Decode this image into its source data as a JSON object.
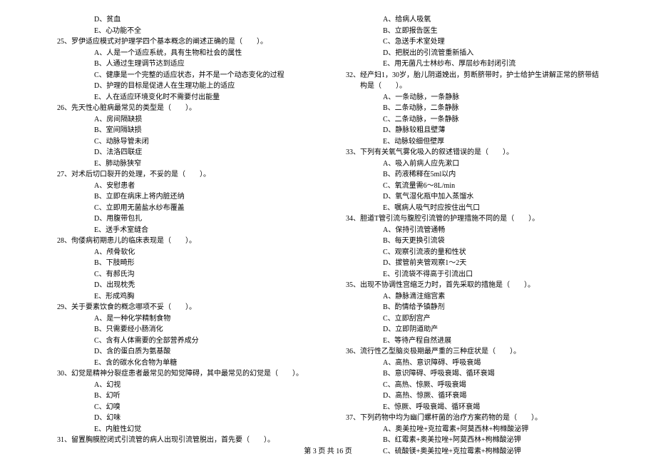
{
  "left": [
    {
      "type": "option",
      "text": "D、贫血"
    },
    {
      "type": "option",
      "text": "E、心功能不全"
    },
    {
      "type": "question",
      "text": "25、罗伊适应模式对护理学四个基本概念的阐述正确的是（　　）。"
    },
    {
      "type": "option",
      "text": "A、人是一个适应系统，具有生物和社会的属性"
    },
    {
      "type": "option",
      "text": "B、人通过生理调节达到适应"
    },
    {
      "type": "option",
      "text": "C、健康是一个完整的适应状态，并不是一个动态变化的过程"
    },
    {
      "type": "option",
      "text": "D、护理的目标是促进人在生理功能上的适应"
    },
    {
      "type": "option",
      "text": "E、人在适应环境变化时不需要付出能量"
    },
    {
      "type": "question",
      "text": "26、先天性心脏病最常见的类型是（　　）。"
    },
    {
      "type": "option",
      "text": "A、房间隔缺损"
    },
    {
      "type": "option",
      "text": "B、室间隔缺损"
    },
    {
      "type": "option",
      "text": "C、动脉导管未闭"
    },
    {
      "type": "option",
      "text": "D、法洛四联症"
    },
    {
      "type": "option",
      "text": "E、肺动脉狭窄"
    },
    {
      "type": "question",
      "text": "27、对术后切口裂开的处理，不妥的是（　　）。"
    },
    {
      "type": "option",
      "text": "A、安慰患者"
    },
    {
      "type": "option",
      "text": "B、立即在病床上将内脏还纳"
    },
    {
      "type": "option",
      "text": "C、立即用无菌盐水纱布覆盖"
    },
    {
      "type": "option",
      "text": "D、用腹带包扎"
    },
    {
      "type": "option",
      "text": "E、送手术室缝合"
    },
    {
      "type": "question",
      "text": "28、佝偻病初期患儿的临床表现是（　　）。"
    },
    {
      "type": "option",
      "text": "A、颅骨软化"
    },
    {
      "type": "option",
      "text": "B、下肢畸形"
    },
    {
      "type": "option",
      "text": "C、有郝氏沟"
    },
    {
      "type": "option",
      "text": "D、出现枕秃"
    },
    {
      "type": "option",
      "text": "E、形成鸡胸"
    },
    {
      "type": "question",
      "text": "29、关于要素饮食的概念哪项不妥（　　）。"
    },
    {
      "type": "option",
      "text": "A、是一种化学精制食物"
    },
    {
      "type": "option",
      "text": "B、只需要经小肠消化"
    },
    {
      "type": "option",
      "text": "C、含有人体需要的全部营养成分"
    },
    {
      "type": "option",
      "text": "D、含的蛋白质为氨基酸"
    },
    {
      "type": "option",
      "text": "E、含的碳水化合物为单糖"
    },
    {
      "type": "question",
      "text": "30、幻觉是精神分裂症患者最常见的知觉障碍，其中最常见的幻觉是（　　）。"
    },
    {
      "type": "option",
      "text": "A、幻视"
    },
    {
      "type": "option",
      "text": "B、幻听"
    },
    {
      "type": "option",
      "text": "C、幻嗅"
    },
    {
      "type": "option",
      "text": "D、幻味"
    },
    {
      "type": "option",
      "text": "E、内脏性幻觉"
    },
    {
      "type": "question",
      "text": "31、留置胸膜腔闭式引流管的病人出现引流管脱出，首先要（　　）。"
    }
  ],
  "right": [
    {
      "type": "option",
      "text": "A、给病人吸氧"
    },
    {
      "type": "option",
      "text": "B、立即报告医生"
    },
    {
      "type": "option",
      "text": "C、急送手术室处理"
    },
    {
      "type": "option",
      "text": "D、把脱出的引流管重新插入"
    },
    {
      "type": "option",
      "text": "E、用无菌凡士林纱布、厚层纱布封闭引流"
    },
    {
      "type": "question",
      "text": "32、经产妇1，30岁，胎儿阴道娩出，剪断脐带时，护士给护生讲解正常的脐带结构是（　　）。"
    },
    {
      "type": "option",
      "text": "A、一条动脉，一条静脉"
    },
    {
      "type": "option",
      "text": "B、二条动脉，二条静脉"
    },
    {
      "type": "option",
      "text": "C、二条动脉，一条静脉"
    },
    {
      "type": "option",
      "text": "D、静脉较粗且壁薄"
    },
    {
      "type": "option",
      "text": "E、动脉较细但壁厚"
    },
    {
      "type": "question",
      "text": "33、下列有关氧气雾化吸入的叙述错误的是（　　）。"
    },
    {
      "type": "option",
      "text": "A、吸入前病人应先漱口"
    },
    {
      "type": "option",
      "text": "B、药液稀释在5ml以内"
    },
    {
      "type": "option",
      "text": "C、氧流量需6～8L/min"
    },
    {
      "type": "option",
      "text": "D、氧气湿化瓶中加入蒸馏水"
    },
    {
      "type": "option",
      "text": "E、嘱病人吸气时应按住出气口"
    },
    {
      "type": "question",
      "text": "34、胆道T管引流与腹腔引流管的护理措施不同的是（　　）。"
    },
    {
      "type": "option",
      "text": "A、保持引流管通畅"
    },
    {
      "type": "option",
      "text": "B、每天更换引流袋"
    },
    {
      "type": "option",
      "text": "C、观察引流液的量和性状"
    },
    {
      "type": "option",
      "text": "D、拔管前夹管观察1～2天"
    },
    {
      "type": "option",
      "text": "E、引流袋不得高于引流出口"
    },
    {
      "type": "question",
      "text": "35、出现不协调性宫缩乏力时，首先采取的措施是（　　）。"
    },
    {
      "type": "option",
      "text": "A、静脉滴注缩宫素"
    },
    {
      "type": "option",
      "text": "B、酌情给予镇静剂"
    },
    {
      "type": "option",
      "text": "C、立即刮宫产"
    },
    {
      "type": "option",
      "text": "D、立即阴道助产"
    },
    {
      "type": "option",
      "text": "E、等待产程自然进展"
    },
    {
      "type": "question",
      "text": "36、流行性乙型脑炎极期最严重的三种症状是（　　）。"
    },
    {
      "type": "option",
      "text": "A、高热、意识障碍、呼吸衰竭"
    },
    {
      "type": "option",
      "text": "B、意识障碍、呼吸衰竭、循环衰竭"
    },
    {
      "type": "option",
      "text": "C、高热、惊厥、呼吸衰竭"
    },
    {
      "type": "option",
      "text": "D、高热、惊厥、循环衰竭"
    },
    {
      "type": "option",
      "text": "E、惊厥、呼吸衰竭、循环衰竭"
    },
    {
      "type": "question",
      "text": "37、下列药物中均为幽门螺杆菌的治疗方案药物的是（　　）。"
    },
    {
      "type": "option",
      "text": "A、奥美拉唑+克拉霉素+阿莫西林+枸橼酸泌钾"
    },
    {
      "type": "option",
      "text": "B、红霉素+奥美拉唑+阿莫西林+枸橼酸泌钾"
    },
    {
      "type": "option",
      "text": "C、硫酸镁+奥美拉唑+克拉霉素+枸橼酸泌钾"
    }
  ],
  "footer": "第 3 页 共 16 页"
}
